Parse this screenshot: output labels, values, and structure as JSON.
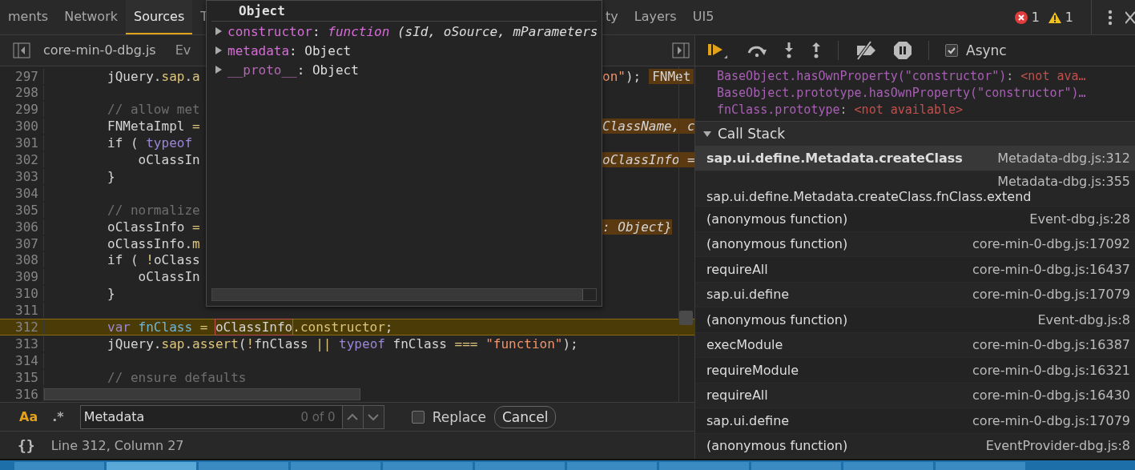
{
  "main_tabs": {
    "left": [
      {
        "label": "ments",
        "selected": false
      },
      {
        "label": "Network",
        "selected": false
      },
      {
        "label": "Sources",
        "selected": true
      },
      {
        "label": "T",
        "selected": false
      }
    ],
    "right": [
      {
        "label": "ty",
        "selected": false
      },
      {
        "label": "Layers",
        "selected": false
      },
      {
        "label": "UI5",
        "selected": false
      }
    ]
  },
  "counters": {
    "errors": "1",
    "warnings": "1"
  },
  "editor_tabs": [
    {
      "label": "core-min-0-dbg.js",
      "selected": true
    },
    {
      "label": "Ev",
      "selected": false
    }
  ],
  "code_lines": [
    {
      "number": "297",
      "left": [
        {
          "text": "        jQuery.",
          "kind": "plain"
        },
        {
          "text": "sap",
          "kind": "prop"
        },
        {
          "text": ".",
          "kind": "plain"
        },
        {
          "text": "a",
          "kind": "prop"
        }
      ],
      "right": [
        {
          "text": "on\"",
          "kind": "string"
        },
        {
          "text": ");",
          "kind": "plain"
        }
      ],
      "badge": "FNMet"
    },
    {
      "number": "298"
    },
    {
      "number": "299",
      "left": [
        {
          "text": "        // allow met",
          "kind": "comment"
        }
      ]
    },
    {
      "number": "300",
      "left": [
        {
          "text": "        FNMetaImpl ",
          "kind": "plain"
        },
        {
          "text": "=",
          "kind": "prop"
        }
      ],
      "right": [
        {
          "text": "ClassName, c",
          "kind": "value"
        }
      ]
    },
    {
      "number": "301",
      "left": [
        {
          "text": "        if ( ",
          "kind": "plain"
        },
        {
          "text": "typeof",
          "kind": "keyword"
        }
      ]
    },
    {
      "number": "302",
      "left": [
        {
          "text": "            oClassIn",
          "kind": "plain"
        }
      ],
      "right": [
        {
          "text": "oClassInfo =",
          "kind": "value"
        }
      ]
    },
    {
      "number": "303",
      "left": [
        {
          "text": "        }",
          "kind": "plain"
        }
      ]
    },
    {
      "number": "304"
    },
    {
      "number": "305",
      "left": [
        {
          "text": "        // normalize",
          "kind": "comment"
        }
      ]
    },
    {
      "number": "306",
      "left": [
        {
          "text": "        oClassInfo ",
          "kind": "plain"
        },
        {
          "text": "=",
          "kind": "prop"
        }
      ],
      "right": [
        {
          "text": ": Object}",
          "kind": "value"
        }
      ]
    },
    {
      "number": "307",
      "left": [
        {
          "text": "        oClassInfo.",
          "kind": "plain"
        },
        {
          "text": "m",
          "kind": "prop"
        }
      ]
    },
    {
      "number": "308",
      "left": [
        {
          "text": "        if ( ",
          "kind": "plain"
        },
        {
          "text": "!",
          "kind": "prop"
        },
        {
          "text": "oClass",
          "kind": "plain"
        }
      ]
    },
    {
      "number": "309",
      "left": [
        {
          "text": "            oClassIn",
          "kind": "plain"
        }
      ]
    },
    {
      "number": "310",
      "left": [
        {
          "text": "        }",
          "kind": "plain"
        }
      ]
    },
    {
      "number": "311"
    },
    {
      "number": "312",
      "current": true,
      "left": [
        {
          "text": "        var ",
          "kind": "keyword"
        },
        {
          "text": "fnClass ",
          "kind": "var"
        },
        {
          "text": "= ",
          "kind": "prop"
        },
        {
          "text": "oClassInfo",
          "kind": "hover"
        },
        {
          "text": ".constructor",
          "kind": "prop"
        },
        {
          "text": ";",
          "kind": "plain"
        }
      ]
    },
    {
      "number": "313",
      "current": false,
      "left": [
        {
          "text": "        jQuery.",
          "kind": "plain"
        },
        {
          "text": "sap",
          "kind": "prop"
        },
        {
          "text": ".",
          "kind": "plain"
        },
        {
          "text": "assert",
          "kind": "prop"
        },
        {
          "text": "(",
          "kind": "plain"
        },
        {
          "text": "!",
          "kind": "prop"
        },
        {
          "text": "fnClass ",
          "kind": "plain"
        },
        {
          "text": "|| ",
          "kind": "prop"
        },
        {
          "text": "typeof",
          "kind": "keyword"
        },
        {
          "text": " fnClass ",
          "kind": "plain"
        },
        {
          "text": "=== ",
          "kind": "prop"
        },
        {
          "text": "\"function\"",
          "kind": "string"
        },
        {
          "text": ");",
          "kind": "plain"
        }
      ]
    },
    {
      "number": "314"
    },
    {
      "number": "315",
      "left": [
        {
          "text": "        // ensure defaults",
          "kind": "comment"
        }
      ]
    },
    {
      "number": "316"
    }
  ],
  "popover": {
    "title": "Object",
    "properties": [
      {
        "name": "constructor",
        "separator": ":",
        "kind": "function",
        "value": "function",
        "detail": " (sId, oSource, mParameters"
      },
      {
        "name": "metadata",
        "separator": ":",
        "kind": "object",
        "value": "Object"
      },
      {
        "name": "__proto__",
        "separator": ":",
        "kind": "proto",
        "value": "Object"
      }
    ]
  },
  "search": {
    "match_case_label": "Aa",
    "match_case": true,
    "regex_label": ".*",
    "regex": false,
    "value": "Metadata",
    "count": "0 of 0",
    "replace_label": "Replace",
    "replace_checked": false,
    "cancel": "Cancel"
  },
  "status_bar": {
    "format_icon": "{}",
    "position": "Line 312, Column 27"
  },
  "debugger": {
    "async_label": "Async",
    "async_checked": true
  },
  "watch": [
    {
      "expression": "BaseObject.hasOwnProperty(\"constructor\")",
      "separator": ":",
      "value": "<not ava…"
    },
    {
      "expression": "BaseObject.prototype.hasOwnProperty(\"constructor\")…"
    },
    {
      "expression": "fnClass.prototype",
      "separator": ":",
      "value": "<not available>"
    }
  ],
  "call_stack": {
    "title": "Call Stack",
    "expanded": true,
    "frames": [
      {
        "name": "sap.ui.define.Metadata.createClass",
        "location": "Metadata-dbg.js:312",
        "selected": true,
        "kind": "inline"
      },
      {
        "name": "sap.ui.define.Metadata.createClass.fnClass.extend",
        "location": "Metadata-dbg.js:355",
        "selected": false,
        "kind": "wrapped"
      },
      {
        "name": "(anonymous function)",
        "location": "Event-dbg.js:28",
        "selected": false,
        "kind": "inline"
      },
      {
        "name": "(anonymous function)",
        "location": "core-min-0-dbg.js:17092",
        "selected": false,
        "kind": "inline"
      },
      {
        "name": "requireAll",
        "location": "core-min-0-dbg.js:16437",
        "selected": false,
        "kind": "inline"
      },
      {
        "name": "sap.ui.define",
        "location": "core-min-0-dbg.js:17079",
        "selected": false,
        "kind": "inline"
      },
      {
        "name": "(anonymous function)",
        "location": "Event-dbg.js:8",
        "selected": false,
        "kind": "inline"
      },
      {
        "name": "execModule",
        "location": "core-min-0-dbg.js:16387",
        "selected": false,
        "kind": "inline"
      },
      {
        "name": "requireModule",
        "location": "core-min-0-dbg.js:16321",
        "selected": false,
        "kind": "inline"
      },
      {
        "name": "requireAll",
        "location": "core-min-0-dbg.js:16430",
        "selected": false,
        "kind": "inline"
      },
      {
        "name": "sap.ui.define",
        "location": "core-min-0-dbg.js:17079",
        "selected": false,
        "kind": "inline"
      },
      {
        "name": "(anonymous function)",
        "location": "EventProvider-dbg.js:8",
        "selected": false,
        "kind": "inline"
      }
    ]
  }
}
